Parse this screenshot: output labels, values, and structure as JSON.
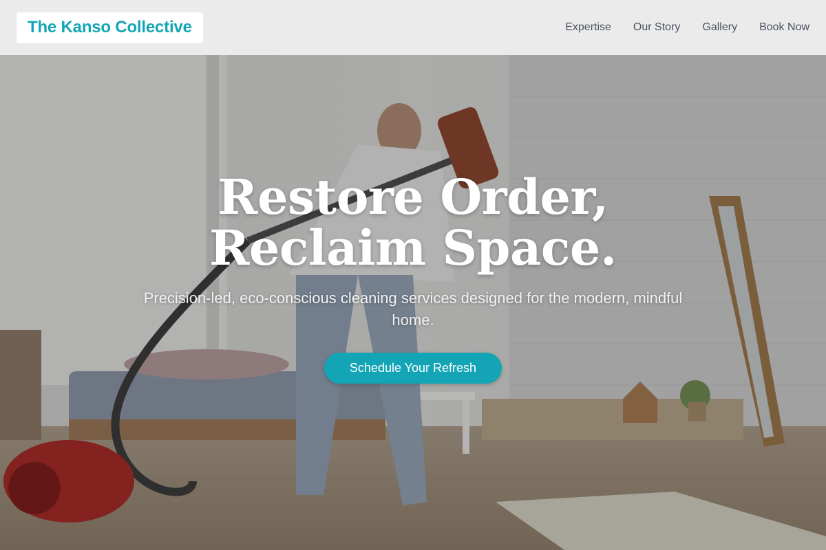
{
  "header": {
    "brand": "The Kanso Collective",
    "nav": [
      "Expertise",
      "Our Story",
      "Gallery",
      "Book Now"
    ]
  },
  "hero": {
    "title": "Restore Order, Reclaim Space.",
    "subtitle": "Precision-led, eco-conscious cleaning services designed for the modern, mindful home.",
    "cta_label": "Schedule Your Refresh",
    "background": "photo of man vacuuming in a bright bedroom"
  },
  "colors": {
    "accent": "#13a5b5",
    "header_bg": "#ececec",
    "nav_text": "#4a5160"
  }
}
